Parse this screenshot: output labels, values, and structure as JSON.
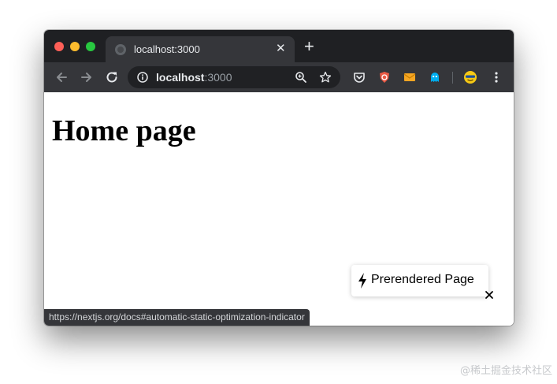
{
  "browser": {
    "tab": {
      "title": "localhost:3000",
      "favicon_icon": "globe-icon",
      "close_icon": "close-icon"
    },
    "new_tab_icon": "plus-icon",
    "toolbar": {
      "back_icon": "arrow-left-icon",
      "forward_icon": "arrow-right-icon",
      "reload_icon": "reload-icon",
      "address": {
        "host": "localhost",
        "port": ":3000",
        "info_icon": "info-icon",
        "zoom_icon": "zoom-icon",
        "bookmark_icon": "star-icon"
      },
      "extensions": [
        "pocket-icon",
        "brave-shield-icon",
        "mail-extension-icon",
        "ghostery-icon"
      ],
      "profile_icon": "profile-avatar-icon",
      "menu_icon": "more-vertical-icon"
    },
    "status_bar_url": "https://nextjs.org/docs#automatic-static-optimization-indicator"
  },
  "page": {
    "heading": "Home page"
  },
  "prerender_indicator": {
    "label": "Prerendered Page",
    "icon": "bolt-icon",
    "close_icon": "close-icon"
  },
  "watermark": "@稀土掘金技术社区",
  "colors": {
    "tabstrip": "#1f2023",
    "toolbar": "#35363a",
    "omnibox": "#202124",
    "traffic_red": "#fe5f57",
    "traffic_yellow": "#febc2e",
    "traffic_green": "#28c840"
  }
}
